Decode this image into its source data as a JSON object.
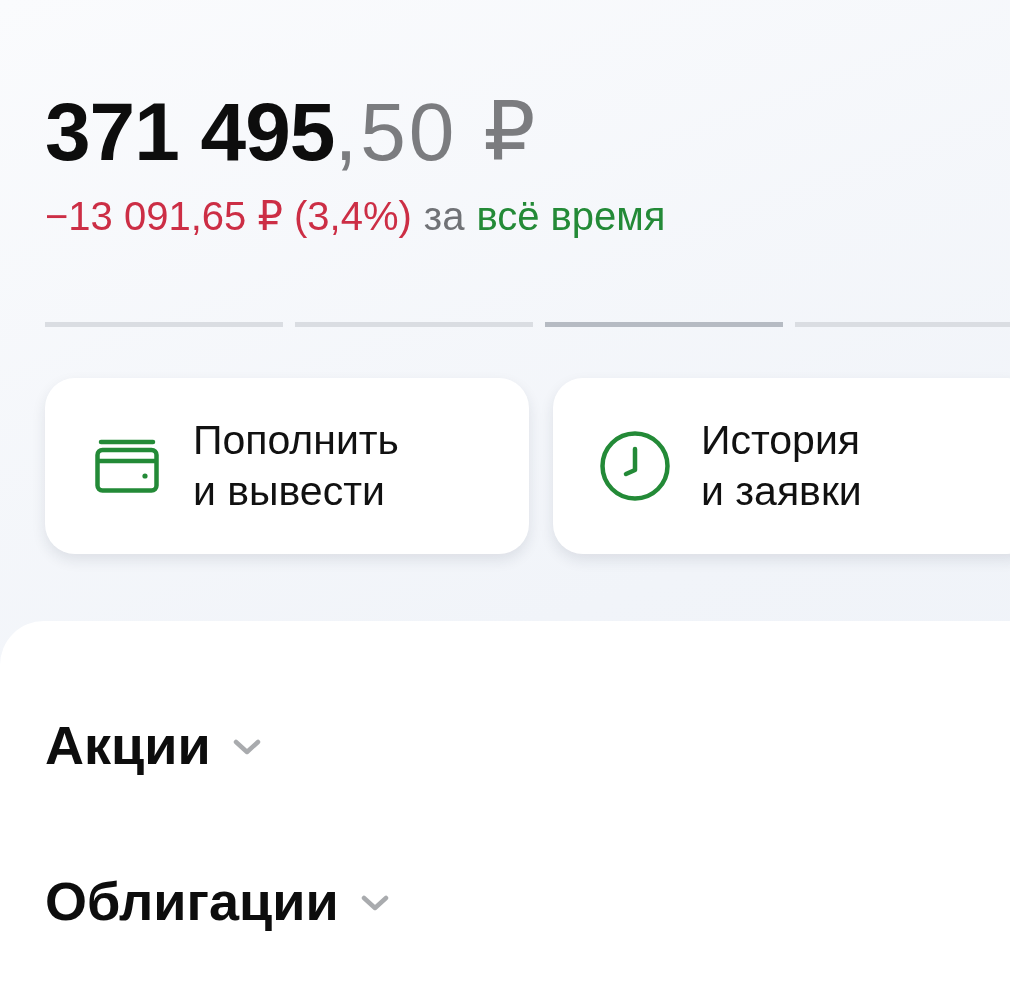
{
  "balance": {
    "whole": "371 495",
    "fraction": ",50 ₽"
  },
  "change": {
    "negative": true,
    "amount": "−13 091,65 ₽ (3,4%)",
    "connector": "за",
    "period": "всё время"
  },
  "pager": [
    {
      "selected": false
    },
    {
      "selected": false
    },
    {
      "selected": true
    },
    {
      "selected": false
    }
  ],
  "actions": [
    {
      "kind": "wallet",
      "label": "Пополнить\nи вывести"
    },
    {
      "kind": "clock",
      "label": "История\nи заявки"
    }
  ],
  "sections": [
    {
      "title": "Акции"
    },
    {
      "title": "Облигации"
    }
  ]
}
